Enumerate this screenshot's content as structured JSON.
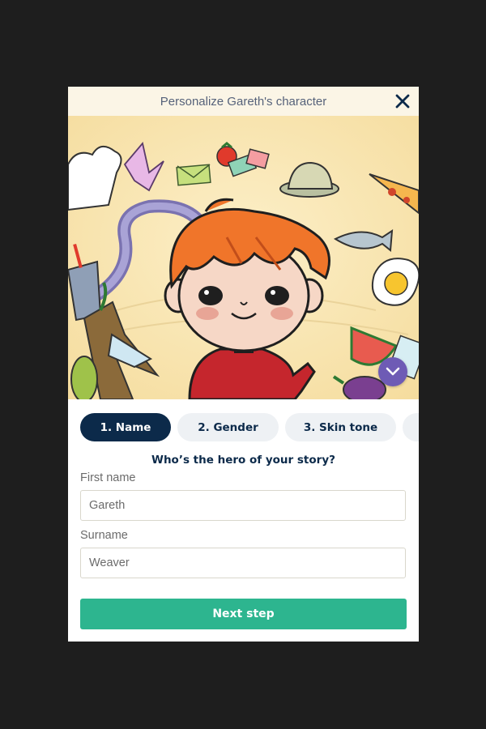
{
  "modal": {
    "title": "Personalize Gareth's character",
    "close_icon": "close-icon",
    "expand_icon": "chevron-down-icon"
  },
  "tabs": [
    {
      "label": "1. Name",
      "active": true
    },
    {
      "label": "2. Gender",
      "active": false
    },
    {
      "label": "3. Skin tone",
      "active": false
    },
    {
      "label": "",
      "active": false
    }
  ],
  "form": {
    "question": "Who’s the hero of your story?",
    "first_name": {
      "label": "First name",
      "value": "Gareth"
    },
    "surname": {
      "label": "Surname",
      "value": "Weaver"
    },
    "next_label": "Next step"
  },
  "colors": {
    "accent": "#0c2a4a",
    "primary_button": "#2db58f",
    "expand_button": "#6e5bb5",
    "header_bg": "#fbf5e6"
  }
}
